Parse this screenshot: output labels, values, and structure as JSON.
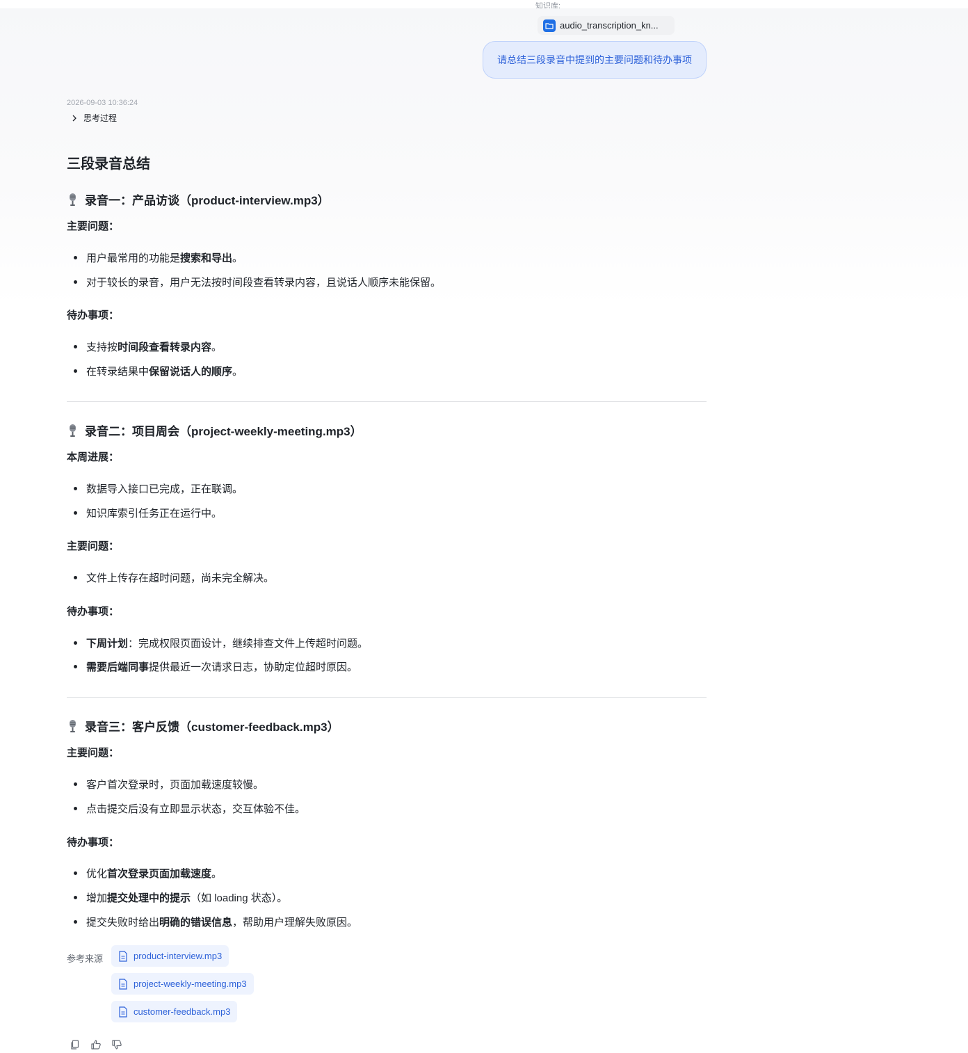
{
  "header": {
    "kb_caption": "知识库:",
    "kb_file": "audio_transcription_kn...",
    "user_message": "请总结三段录音中提到的主要问题和待办事项"
  },
  "reply": {
    "timestamp": "2026-09-03 10:36:24",
    "thinking_label": "思考过程",
    "title": "三段录音总结",
    "s1": {
      "heading": "录音一：产品访谈（product-interview.mp3）",
      "problems_label": "主要问题：",
      "p1_a": "用户最常用的功能是",
      "p1_b": "搜索和导出",
      "p1_c": "。",
      "p2": "对于较长的录音，用户无法按时间段查看转录内容，且说话人顺序未能保留。",
      "todo_label": "待办事项：",
      "t1_a": "支持按",
      "t1_b": "时间段查看转录内容",
      "t1_c": "。",
      "t2_a": "在转录结果中",
      "t2_b": "保留说话人的顺序",
      "t2_c": "。"
    },
    "s2": {
      "heading": "录音二：项目周会（project-weekly-meeting.mp3）",
      "progress_label": "本周进展：",
      "g1": "数据导入接口已完成，正在联调。",
      "g2": "知识库索引任务正在运行中。",
      "problems_label": "主要问题：",
      "p1": "文件上传存在超时问题，尚未完全解决。",
      "todo_label": "待办事项：",
      "t1_a": "下周计划",
      "t1_b": "：完成权限页面设计，继续排查文件上传超时问题。",
      "t2_a": "需要后端同事",
      "t2_b": "提供最近一次请求日志，协助定位超时原因。"
    },
    "s3": {
      "heading": "录音三：客户反馈（customer-feedback.mp3）",
      "problems_label": "主要问题：",
      "p1": "客户首次登录时，页面加载速度较慢。",
      "p2": "点击提交后没有立即显示状态，交互体验不佳。",
      "todo_label": "待办事项：",
      "t1_a": "优化",
      "t1_b": "首次登录页面加载速度",
      "t1_c": "。",
      "t2_a": "增加",
      "t2_b": "提交处理中的提示",
      "t2_c": "（如 loading 状态）。",
      "t3_a": "提交失败时给出",
      "t3_b": "明确的错误信息",
      "t3_c": "，帮助用户理解失败原因。"
    },
    "refs_label": "参考来源",
    "refs": [
      "product-interview.mp3",
      "project-weekly-meeting.mp3",
      "customer-feedback.mp3"
    ]
  },
  "colors": {
    "accent": "#2e62d9",
    "bubble_bg": "#e4ecfd",
    "chip_bg": "#eef3fe"
  },
  "icons": [
    "folder-icon",
    "chevron-right-icon",
    "microphone-icon",
    "document-icon",
    "copy-icon",
    "thumbs-up-icon",
    "thumbs-down-icon"
  ]
}
